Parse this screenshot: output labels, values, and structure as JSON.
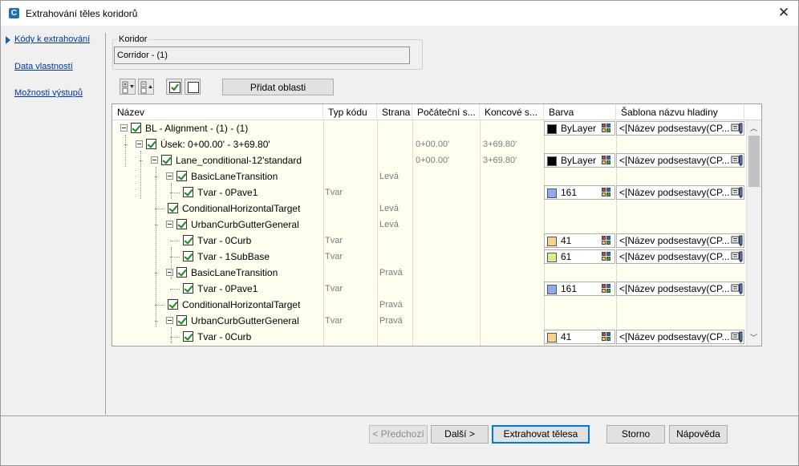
{
  "window": {
    "title": "Extrahování těles koridorů",
    "close_glyph": "✕",
    "app_icon": "C"
  },
  "nav": {
    "items": [
      "Kódy k extrahování",
      "Data vlastností",
      "Možnosti výstupů"
    ]
  },
  "corridor": {
    "label": "Koridor",
    "value": "Corridor - (1)"
  },
  "toolbar": {
    "add_regions_label": "Přidat oblasti"
  },
  "grid": {
    "headers": [
      "Název",
      "Typ kódu",
      "Strana",
      "Počáteční s...",
      "Koncové s...",
      "Barva",
      "Šablona názvu hladiny"
    ],
    "rows": [
      {
        "name": "BL - Alignment - (1) - (1)",
        "type": "",
        "side": "",
        "start": "",
        "end": "",
        "color": "ByLayer",
        "swatch": "#000000",
        "layer": "<[Název podsestavy(CP..."
      },
      {
        "name": "Úsek: 0+00.00' - 3+69.80'",
        "type": "",
        "side": "",
        "start": "0+00.00'",
        "end": "3+69.80'",
        "color": "",
        "swatch": "",
        "layer": ""
      },
      {
        "name": "Lane_conditional-12'standard",
        "type": "",
        "side": "",
        "start": "0+00.00'",
        "end": "3+69.80'",
        "color": "ByLayer",
        "swatch": "#000000",
        "layer": "<[Název podsestavy(CP..."
      },
      {
        "name": "BasicLaneTransition",
        "type": "",
        "side": "Levá",
        "start": "",
        "end": "",
        "color": "",
        "swatch": "",
        "layer": ""
      },
      {
        "name": "Tvar - 0Pave1",
        "type": "Tvar",
        "side": "",
        "start": "",
        "end": "",
        "color": "161",
        "swatch": "#8fa8ee",
        "layer": "<[Název podsestavy(CP..."
      },
      {
        "name": "ConditionalHorizontalTarget",
        "type": "",
        "side": "Levá",
        "start": "",
        "end": "",
        "color": "",
        "swatch": "",
        "layer": ""
      },
      {
        "name": "UrbanCurbGutterGeneral",
        "type": "",
        "side": "Levá",
        "start": "",
        "end": "",
        "color": "",
        "swatch": "",
        "layer": ""
      },
      {
        "name": "Tvar - 0Curb",
        "type": "Tvar",
        "side": "",
        "start": "",
        "end": "",
        "color": "41",
        "swatch": "#f7d38f",
        "layer": "<[Název podsestavy(CP..."
      },
      {
        "name": "Tvar - 1SubBase",
        "type": "Tvar",
        "side": "",
        "start": "",
        "end": "",
        "color": "61",
        "swatch": "#d8f08a",
        "layer": "<[Název podsestavy(CP..."
      },
      {
        "name": "BasicLaneTransition",
        "type": "",
        "side": "Pravá",
        "start": "",
        "end": "",
        "color": "",
        "swatch": "",
        "layer": ""
      },
      {
        "name": "Tvar - 0Pave1",
        "type": "Tvar",
        "side": "",
        "start": "",
        "end": "",
        "color": "161",
        "swatch": "#8fa8ee",
        "layer": "<[Název podsestavy(CP..."
      },
      {
        "name": "ConditionalHorizontalTarget",
        "type": "",
        "side": "Pravá",
        "start": "",
        "end": "",
        "color": "",
        "swatch": "",
        "layer": ""
      },
      {
        "name": "UrbanCurbGutterGeneral",
        "type": "Tvar",
        "side": "Pravá",
        "start": "",
        "end": "",
        "color": "",
        "swatch": "",
        "layer": ""
      },
      {
        "name": "Tvar - 0Curb",
        "type": "",
        "side": "",
        "start": "",
        "end": "",
        "color": "41",
        "swatch": "#f7d38f",
        "layer": "<[Název podsestavy(CP..."
      }
    ]
  },
  "footer": {
    "prev": "< Předchozí",
    "next": "Další >",
    "extract": "Extrahovat tělesa",
    "cancel": "Storno",
    "help": "Nápověda"
  }
}
